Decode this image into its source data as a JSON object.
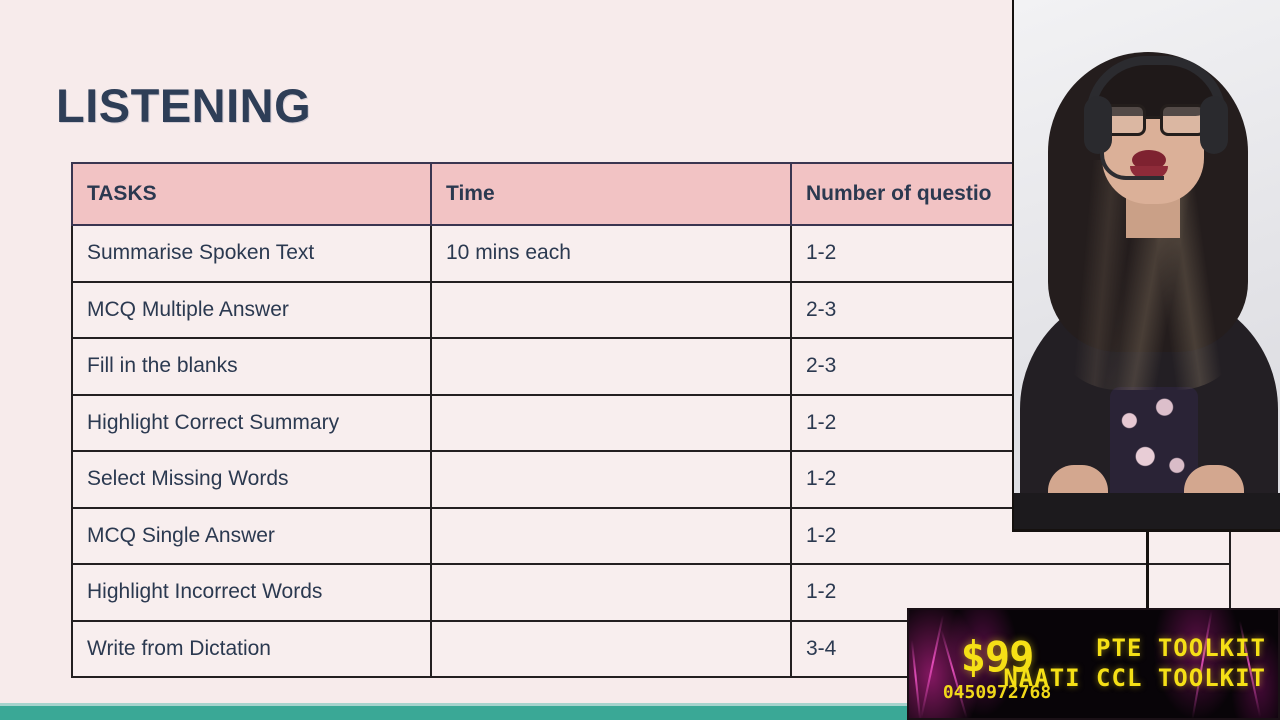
{
  "slide": {
    "title": "LISTENING",
    "background_color": "#f7ebeb",
    "title_color": "#2e3e57",
    "accent_band_color": "#3aa896"
  },
  "table": {
    "header_bg": "#f2c3c4",
    "cell_bg": "#f8eeee",
    "columns": [
      "TASKS",
      "Time",
      "Number of questio"
    ],
    "rows": [
      {
        "task": "Summarise Spoken Text",
        "time": "10 mins each",
        "questions": "1-2"
      },
      {
        "task": "MCQ Multiple Answer",
        "time": "",
        "questions": "2-3"
      },
      {
        "task": "Fill in the blanks",
        "time": "",
        "questions": "2-3"
      },
      {
        "task": "Highlight Correct Summary",
        "time": "",
        "questions": "1-2"
      },
      {
        "task": "Select Missing Words",
        "time": "",
        "questions": "1-2"
      },
      {
        "task": "MCQ Single Answer",
        "time": "",
        "questions": "1-2"
      },
      {
        "task": "Highlight Incorrect Words",
        "time": "",
        "questions": "1-2"
      },
      {
        "task": "Write from Dictation",
        "time": "",
        "questions": "3-4"
      }
    ]
  },
  "webcam": {
    "label": "presenter-video"
  },
  "promo_banner": {
    "price": "$99",
    "phone": "0450972768",
    "line1": "PTE TOOLKIT",
    "line2": "NAATI CCL TOOLKIT",
    "text_color": "#f5e016",
    "background_color": "#080408"
  }
}
